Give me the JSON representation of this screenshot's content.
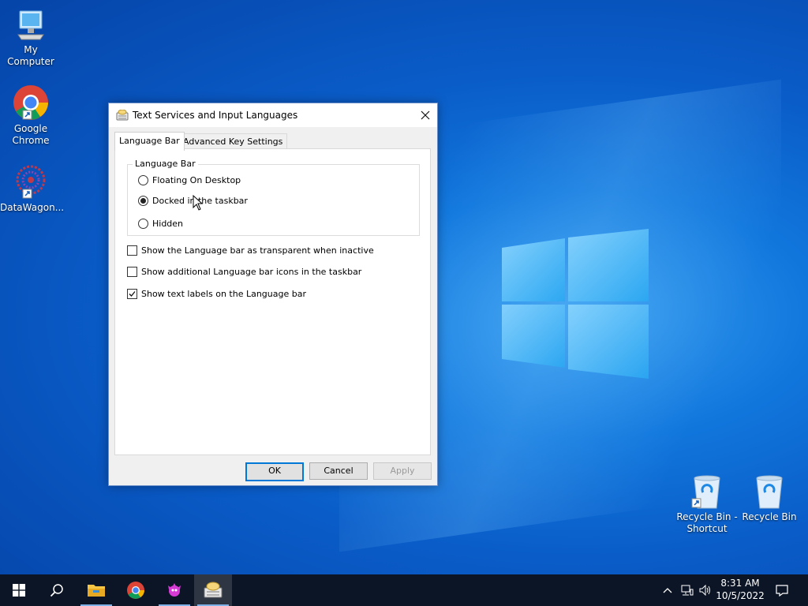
{
  "desktop": {
    "icons": [
      {
        "label": "My Computer",
        "icon": "computer-icon"
      },
      {
        "label": "Google Chrome",
        "icon": "chrome-icon"
      },
      {
        "label": "DataWagon...",
        "icon": "datawagon-icon"
      },
      {
        "label": "Recycle Bin - Shortcut",
        "icon": "recycle-bin-icon"
      },
      {
        "label": "Recycle Bin",
        "icon": "recycle-bin-icon"
      }
    ]
  },
  "dialog": {
    "title": "Text Services and Input Languages",
    "tabs": [
      {
        "label": "Language Bar",
        "active": true
      },
      {
        "label": "Advanced Key Settings",
        "active": false
      }
    ],
    "group_label": "Language Bar",
    "radios": [
      {
        "label": "Floating On Desktop",
        "selected": false
      },
      {
        "label": "Docked in the taskbar",
        "selected": true
      },
      {
        "label": "Hidden",
        "selected": false
      }
    ],
    "checkboxes": [
      {
        "label": "Show the Language bar as transparent when inactive",
        "checked": false
      },
      {
        "label": "Show additional Language bar icons in the taskbar",
        "checked": false
      },
      {
        "label": "Show text labels on the Language bar",
        "checked": true
      }
    ],
    "buttons": {
      "ok": "OK",
      "cancel": "Cancel",
      "apply": "Apply"
    }
  },
  "taskbar": {
    "items": [
      "start-icon",
      "search-icon",
      "file-explorer-icon",
      "chrome-icon",
      "datawagon-icon",
      "text-services-icon"
    ],
    "clock": {
      "time": "8:31 AM",
      "date": "10/5/2022"
    }
  },
  "colors": {
    "accent": "#0078d7",
    "taskbar": "#0c1525"
  }
}
